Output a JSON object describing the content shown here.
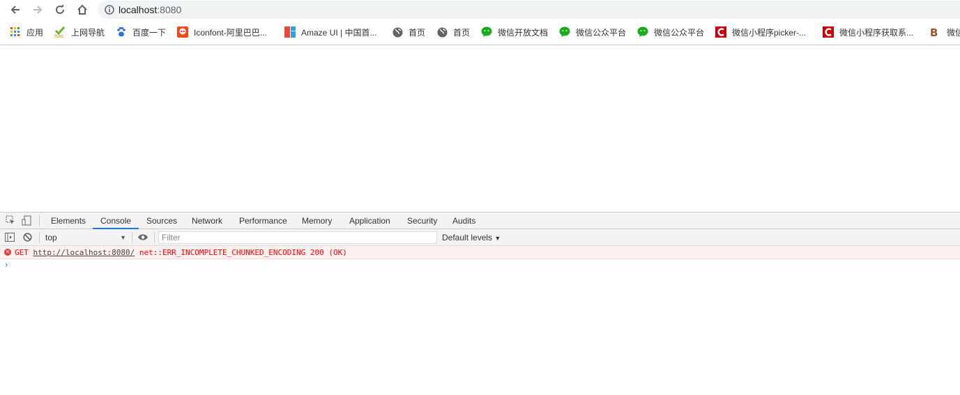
{
  "browser": {
    "url_host": "localhost",
    "url_port": ":8080",
    "bookmarks": [
      {
        "label": "应用",
        "icon": "apps-grid-icon"
      },
      {
        "label": "上网导航",
        "icon": "hao-icon"
      },
      {
        "label": "百度一下",
        "icon": "baidu-paw-icon"
      },
      {
        "label": "Iconfont-阿里巴巴...",
        "icon": "iconfont-icon"
      },
      {
        "label": "Amaze UI | 中国首...",
        "icon": "amaze-icon"
      },
      {
        "label": "首页",
        "icon": "globe-icon"
      },
      {
        "label": "首页",
        "icon": "globe-icon"
      },
      {
        "label": "微信开放文档",
        "icon": "wechat-icon"
      },
      {
        "label": "微信公众平台",
        "icon": "wechat-icon"
      },
      {
        "label": "微信公众平台",
        "icon": "wechat-icon"
      },
      {
        "label": "微信小程序picker-...",
        "icon": "csdn-icon"
      },
      {
        "label": "微信小程序获取系...",
        "icon": "csdn-icon"
      },
      {
        "label": "微信",
        "icon": "b-icon"
      }
    ]
  },
  "devtools": {
    "tabs": [
      "Elements",
      "Console",
      "Sources",
      "Network",
      "Performance",
      "Memory",
      "Application",
      "Security",
      "Audits"
    ],
    "active_tab": "Console",
    "context": "top",
    "filter_placeholder": "Filter",
    "levels": "Default levels",
    "error": {
      "method": "GET",
      "url": "http://localhost:8080/",
      "message": "net::ERR_INCOMPLETE_CHUNKED_ENCODING 200 (OK)"
    },
    "prompt": "›"
  },
  "colors": {
    "error": "#ff0000",
    "accent": "#1a73e8",
    "wechat": "#1aad19",
    "csdn": "#c9000a"
  }
}
